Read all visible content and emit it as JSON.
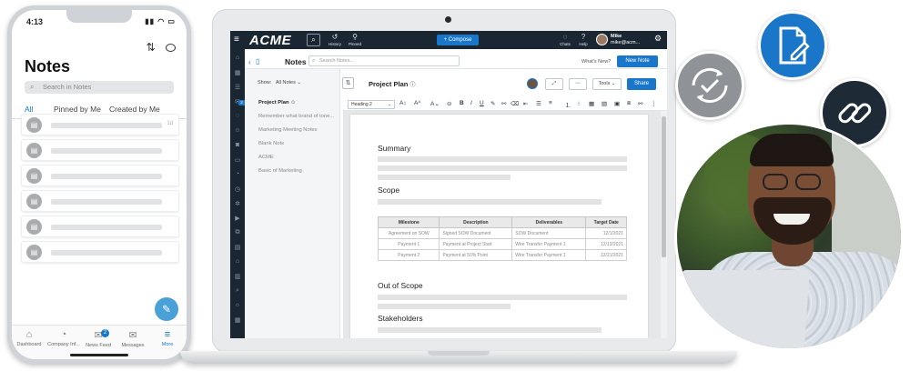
{
  "phone": {
    "status_time": "4:13",
    "status_icons": "▮▮ ◠ ▭",
    "sort_icon": "⇅",
    "chat_icon": "💬",
    "title": "Notes",
    "search_placeholder": "Search in Notes",
    "tabs": [
      {
        "label": "All",
        "active": true
      },
      {
        "label": "Pinned by Me",
        "active": false
      },
      {
        "label": "Created by Me",
        "active": false
      }
    ],
    "list_item_count": 6,
    "first_item_meta": "1d",
    "fab_icon": "✎",
    "bottom_nav": [
      {
        "label": "Dashboard",
        "icon": "⌂",
        "active": false
      },
      {
        "label": "Company Inf...",
        "icon": "◔",
        "active": false
      },
      {
        "label": "News Feed",
        "icon": "✉",
        "active": false,
        "badge": "2"
      },
      {
        "label": "Messages",
        "icon": "✉",
        "active": false
      },
      {
        "label": "More",
        "icon": "≡",
        "active": true
      }
    ]
  },
  "app": {
    "logo": "ACME",
    "topbar": {
      "history_label": "History",
      "pinned_label": "Pinned",
      "compose_label": "+ Compose",
      "chats_label": "Chats",
      "help_label": "Help",
      "user_name": "Mike",
      "user_email": "mike@acm..."
    },
    "sidebar_badge": "2",
    "header": {
      "title": "Notes",
      "search_placeholder": "Search Notes...",
      "whats_new": "What's New?",
      "new_note": "New Note"
    },
    "notes_list": {
      "show_label": "Show:",
      "filter": "All Notes",
      "items": [
        {
          "label": "Project Plan",
          "active": true
        },
        {
          "label": "Remember what brand of tone...",
          "active": false
        },
        {
          "label": "Marketing Meeting Notes",
          "active": false
        },
        {
          "label": "Blank Note",
          "active": false
        },
        {
          "label": "ACME",
          "active": false
        },
        {
          "label": "Basic of Marketing",
          "active": false
        }
      ]
    },
    "editor": {
      "title": "Project Plan",
      "tools_label": "Tools",
      "share_label": "Share",
      "heading_select": "Heading 2"
    },
    "document": {
      "headings": [
        "Summary",
        "Scope",
        "Out of Scope",
        "Stakeholders"
      ],
      "table": {
        "headers": [
          "Milestone",
          "Description",
          "Deliverables",
          "Target Date"
        ],
        "rows": [
          [
            "Agreement on SOW",
            "Signed SOW Document",
            "SOW Document",
            "12/1/2021"
          ],
          [
            "Payment 1",
            "Payment at Project Start",
            "Wire Transfer Payment 1",
            "12/13/2021"
          ],
          [
            "Payment 2",
            "Payment at 50% Point",
            "Wire Transfer Payment 1",
            "12/21/2021"
          ]
        ]
      }
    }
  },
  "colors": {
    "brand_blue": "#1976c9",
    "topbar_dark": "#1b2633",
    "link_circle": "#1e2a36",
    "sync_circle": "#8f9397"
  },
  "icons": {
    "sync": "sync-check-icon",
    "document_edit": "document-edit-icon",
    "link": "chain-link-icon"
  }
}
